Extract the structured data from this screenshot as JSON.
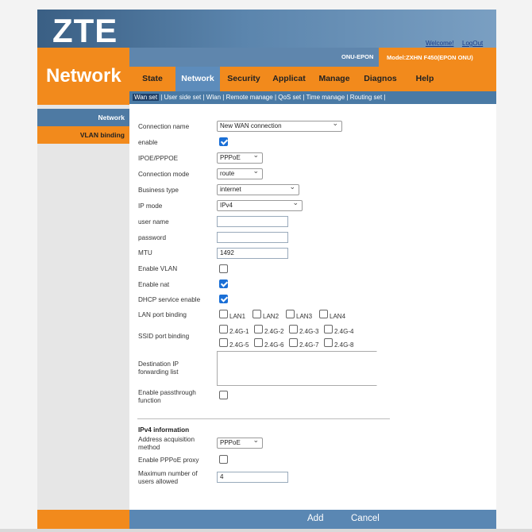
{
  "header": {
    "logo": "ZTE",
    "welcome": "Welcome!",
    "logout": "LogOut",
    "section_title": "Network",
    "onu_label": "ONU-EPON",
    "model": "Model:ZXHN F450(EPON ONU)"
  },
  "tabs": [
    {
      "label": "State",
      "active": false
    },
    {
      "label": "Network",
      "active": true
    },
    {
      "label": "Security",
      "active": false
    },
    {
      "label": "Applicat",
      "active": false
    },
    {
      "label": "Manage",
      "active": false
    },
    {
      "label": "Diagnos",
      "active": false
    },
    {
      "label": "Help",
      "active": false
    }
  ],
  "subnav": {
    "items": [
      "Wan set",
      "User side set",
      "Wlan",
      "Remote manage",
      "QoS set",
      "Time manage",
      "Routing set"
    ],
    "current": "Wan set"
  },
  "sidebar": {
    "items": [
      {
        "label": "Network",
        "active": true
      },
      {
        "label": "VLAN binding",
        "active": false
      }
    ]
  },
  "form": {
    "connection_name": {
      "label": "Connection name",
      "value": "New WAN connection"
    },
    "enable": {
      "label": "enable",
      "checked": true
    },
    "ipoe_pppoe": {
      "label": "IPOE/PPPOE",
      "value": "PPPoE"
    },
    "connection_mode": {
      "label": "Connection mode",
      "value": "route"
    },
    "business_type": {
      "label": "Business type",
      "value": "internet"
    },
    "ip_mode": {
      "label": "IP mode",
      "value": "IPv4"
    },
    "user_name": {
      "label": "user name",
      "value": ""
    },
    "password": {
      "label": "password",
      "value": ""
    },
    "mtu": {
      "label": "MTU",
      "value": "1492"
    },
    "enable_vlan": {
      "label": "Enable VLAN",
      "checked": false
    },
    "enable_nat": {
      "label": "Enable nat",
      "checked": true
    },
    "dhcp": {
      "label": "DHCP service enable",
      "checked": true
    },
    "lan_binding": {
      "label": "LAN port binding",
      "ports": [
        "LAN1",
        "LAN2",
        "LAN3",
        "LAN4"
      ]
    },
    "ssid_binding": {
      "label": "SSID port binding",
      "row1": [
        "2.4G-1",
        "2.4G-2",
        "2.4G-3",
        "2.4G-4"
      ],
      "row2": [
        "2.4G-5",
        "2.4G-6",
        "2.4G-7",
        "2.4G-8"
      ]
    },
    "dest_ip": {
      "label_line1": "Destination IP",
      "label_line2": "forwarding list"
    },
    "passthrough": {
      "label_line1": "Enable passthrough",
      "label_line2": "function",
      "checked": false
    }
  },
  "ipv4": {
    "title": "IPv4 information",
    "addr_method": {
      "label_line1": "Address acquisition",
      "label_line2": "method",
      "value": "PPPoE"
    },
    "pppoe_proxy": {
      "label": "Enable PPPoE proxy",
      "checked": false
    },
    "max_users": {
      "label_line1": "Maximum number of",
      "label_line2": "users allowed",
      "value": "4"
    }
  },
  "buttons": {
    "add": "Add",
    "cancel": "Cancel"
  },
  "colors": {
    "orange": "#f28a1c",
    "blue": "#5f86ad",
    "check": "#1a6fd6"
  }
}
